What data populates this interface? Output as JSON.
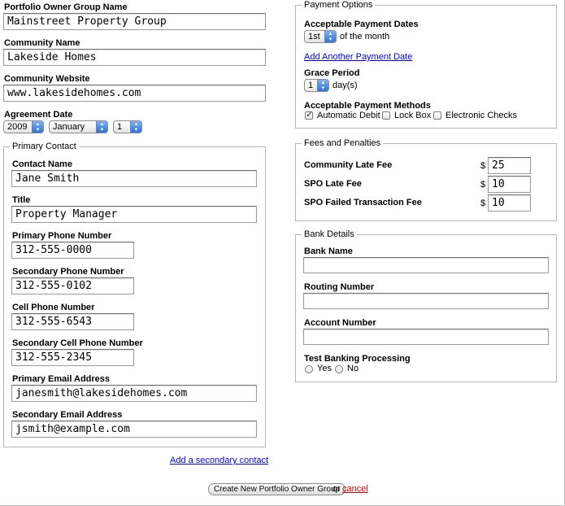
{
  "owner": {
    "portfolio_label": "Portfolio Owner Group Name",
    "portfolio_value": "Mainstreet Property Group",
    "community_label": "Community Name",
    "community_value": "Lakeside Homes",
    "website_label": "Community Website",
    "website_value": "www.lakesidehomes.com",
    "agreement_label": "Agreement Date",
    "agreement_year": "2009",
    "agreement_month": "January",
    "agreement_day": "1"
  },
  "primary_contact": {
    "legend": "Primary Contact",
    "contact_name_label": "Contact Name",
    "contact_name_value": "Jane Smith",
    "title_label": "Title",
    "title_value": "Property Manager",
    "primary_phone_label": "Primary Phone Number",
    "primary_phone_value": "312-555-0000",
    "secondary_phone_label": "Secondary Phone Number",
    "secondary_phone_value": "312-555-0102",
    "cell_label": "Cell Phone Number",
    "cell_value": "312-555-6543",
    "secondary_cell_label": "Secondary Cell Phone Number",
    "secondary_cell_value": "312-555-2345",
    "primary_email_label": "Primary Email Address",
    "primary_email_value": "janesmith@lakesidehomes.com",
    "secondary_email_label": "Secondary Email Address",
    "secondary_email_value": "jsmith@example.com"
  },
  "add_secondary_contact": "Add a secondary contact",
  "payment_options": {
    "legend": "Payment Options",
    "dates_label": "Acceptable Payment Dates",
    "date_value": "1st",
    "of_the_month": "of the month",
    "add_date_link": "Add Another Payment Date",
    "grace_label": "Grace Period",
    "grace_value": "1",
    "grace_unit": "day(s)",
    "methods_label": "Acceptable Payment Methods",
    "methods": [
      {
        "label": "Automatic Debit",
        "checked": true
      },
      {
        "label": "Lock Box",
        "checked": false
      },
      {
        "label": "Electronic Checks",
        "checked": false
      }
    ]
  },
  "fees": {
    "legend": "Fees and Penalties",
    "currency": "$",
    "items": [
      {
        "label": "Community Late Fee",
        "value": "25"
      },
      {
        "label": "SPO Late Fee",
        "value": "10"
      },
      {
        "label": "SPO Failed Transaction Fee",
        "value": "10"
      }
    ]
  },
  "bank": {
    "legend": "Bank Details",
    "bank_name_label": "Bank Name",
    "bank_name_value": "",
    "routing_label": "Routing Number",
    "routing_value": "",
    "account_label": "Account Number",
    "account_value": "",
    "test_label": "Test Banking Processing",
    "yes_label": "Yes",
    "no_label": "No"
  },
  "footer": {
    "create_button": "Create New Portfolio Owner Group",
    "or_text": "or",
    "cancel_link": "cancel"
  },
  "icons": {
    "select_arrows": "up-down-arrows-icon",
    "checkmark": "checkmark-icon"
  },
  "colors": {
    "link": "#0000ee",
    "cancel": "#dd0000",
    "select_arrow": "#2f72d4"
  }
}
